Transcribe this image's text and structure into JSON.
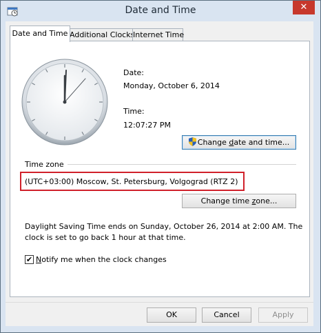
{
  "window": {
    "title": "Date and Time",
    "close_glyph": "✕"
  },
  "tabs": [
    {
      "label": "Date and Time",
      "active": true
    },
    {
      "label": "Additional Clocks",
      "active": false
    },
    {
      "label": "Internet Time",
      "active": false
    }
  ],
  "datetime": {
    "date_label": "Date:",
    "date_value": "Monday, October 6, 2014",
    "time_label": "Time:",
    "time_value": "12:07:27 PM",
    "change_button_pre": "Change ",
    "change_button_accel": "d",
    "change_button_post": "ate and time..."
  },
  "timezone": {
    "group_label": "Time zone",
    "value": "(UTC+03:00) Moscow, St. Petersburg, Volgograd (RTZ 2)",
    "change_button_pre": "Change time ",
    "change_button_accel": "z",
    "change_button_post": "one...",
    "highlight_color": "#d0202a"
  },
  "dst": {
    "message_line1": "Daylight Saving Time ends on Sunday, October 26, 2014 at 2:00 AM. The",
    "message_line2": "clock is set to go back 1 hour at that time."
  },
  "notify": {
    "checked": true,
    "check_glyph": "✔",
    "label_accel": "N",
    "label_rest": "otify me when the clock changes"
  },
  "footer": {
    "ok_label": "OK",
    "cancel_label": "Cancel",
    "apply_label": "Apply"
  },
  "icons": {
    "title": "date-time-icon",
    "shield": "uac-shield-icon"
  }
}
